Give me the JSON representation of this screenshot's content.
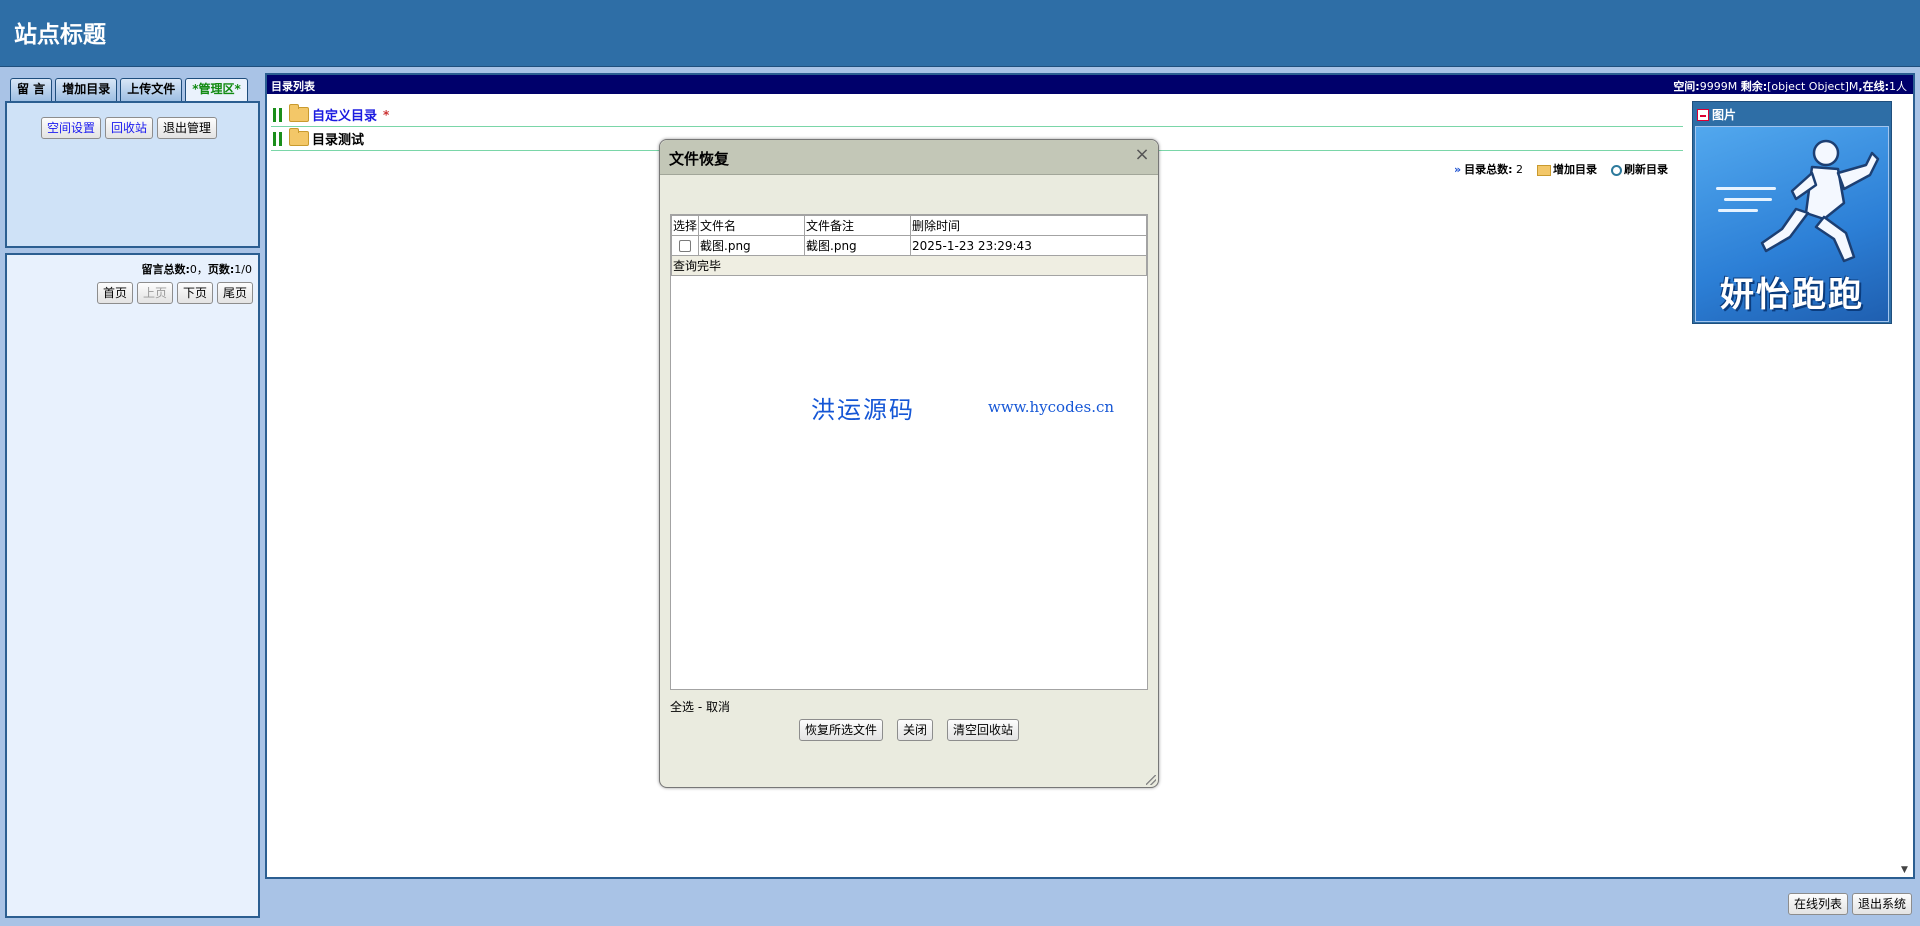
{
  "site": {
    "title": "站点标题"
  },
  "left": {
    "tabs": [
      {
        "label": "留 言"
      },
      {
        "label": "增加目录"
      },
      {
        "label": "上传文件"
      },
      {
        "label": "*管理区*"
      }
    ],
    "admin_buttons": {
      "space_settings": "空间设置",
      "recycle_bin": "回收站",
      "logout_admin": "退出管理"
    },
    "messages": {
      "total_label": "留言总数:",
      "total_value": "0",
      "sep": "，",
      "pages_label": "页数:",
      "pages_value": "1/0",
      "pager": {
        "first": "首页",
        "prev": "上页",
        "next": "下页",
        "last": "尾页"
      }
    }
  },
  "main": {
    "bar_title": "目录列表",
    "bar_right": {
      "space_label": "空间:",
      "space_value": "9999M",
      "remain_label": "剩余:",
      "remain_value": "[object Object]M",
      "online_label": ",在线:",
      "online_value": "1人"
    },
    "directories": [
      {
        "name": "自定义目录",
        "star": "*"
      },
      {
        "name": "目录测试"
      }
    ],
    "toolbar": {
      "total_label": "目录总数:",
      "total_value": "2",
      "add_dir": "增加目录",
      "refresh_dir": "刷新目录"
    }
  },
  "image_panel": {
    "title": "图片",
    "logo_text": "妍怡跑跑"
  },
  "footer": {
    "online_list": "在线列表",
    "logout_system": "退出系统"
  },
  "dialog": {
    "title": "文件恢复",
    "close_glyph": "×",
    "columns": [
      "选择",
      "文件名",
      "文件备注",
      "删除时间"
    ],
    "rows": [
      {
        "filename": "截图.png",
        "note": "截图.png",
        "deleted_at": "2025-1-23 23:29:43"
      }
    ],
    "done_text": "查询完毕",
    "watermark_cn": "洪运源码",
    "watermark_url": "www.hycodes.cn",
    "select_all": "全选",
    "select_sep": " - ",
    "cancel": "取消",
    "buttons": {
      "restore": "恢复所选文件",
      "close": "关闭",
      "empty": "清空回收站"
    }
  }
}
